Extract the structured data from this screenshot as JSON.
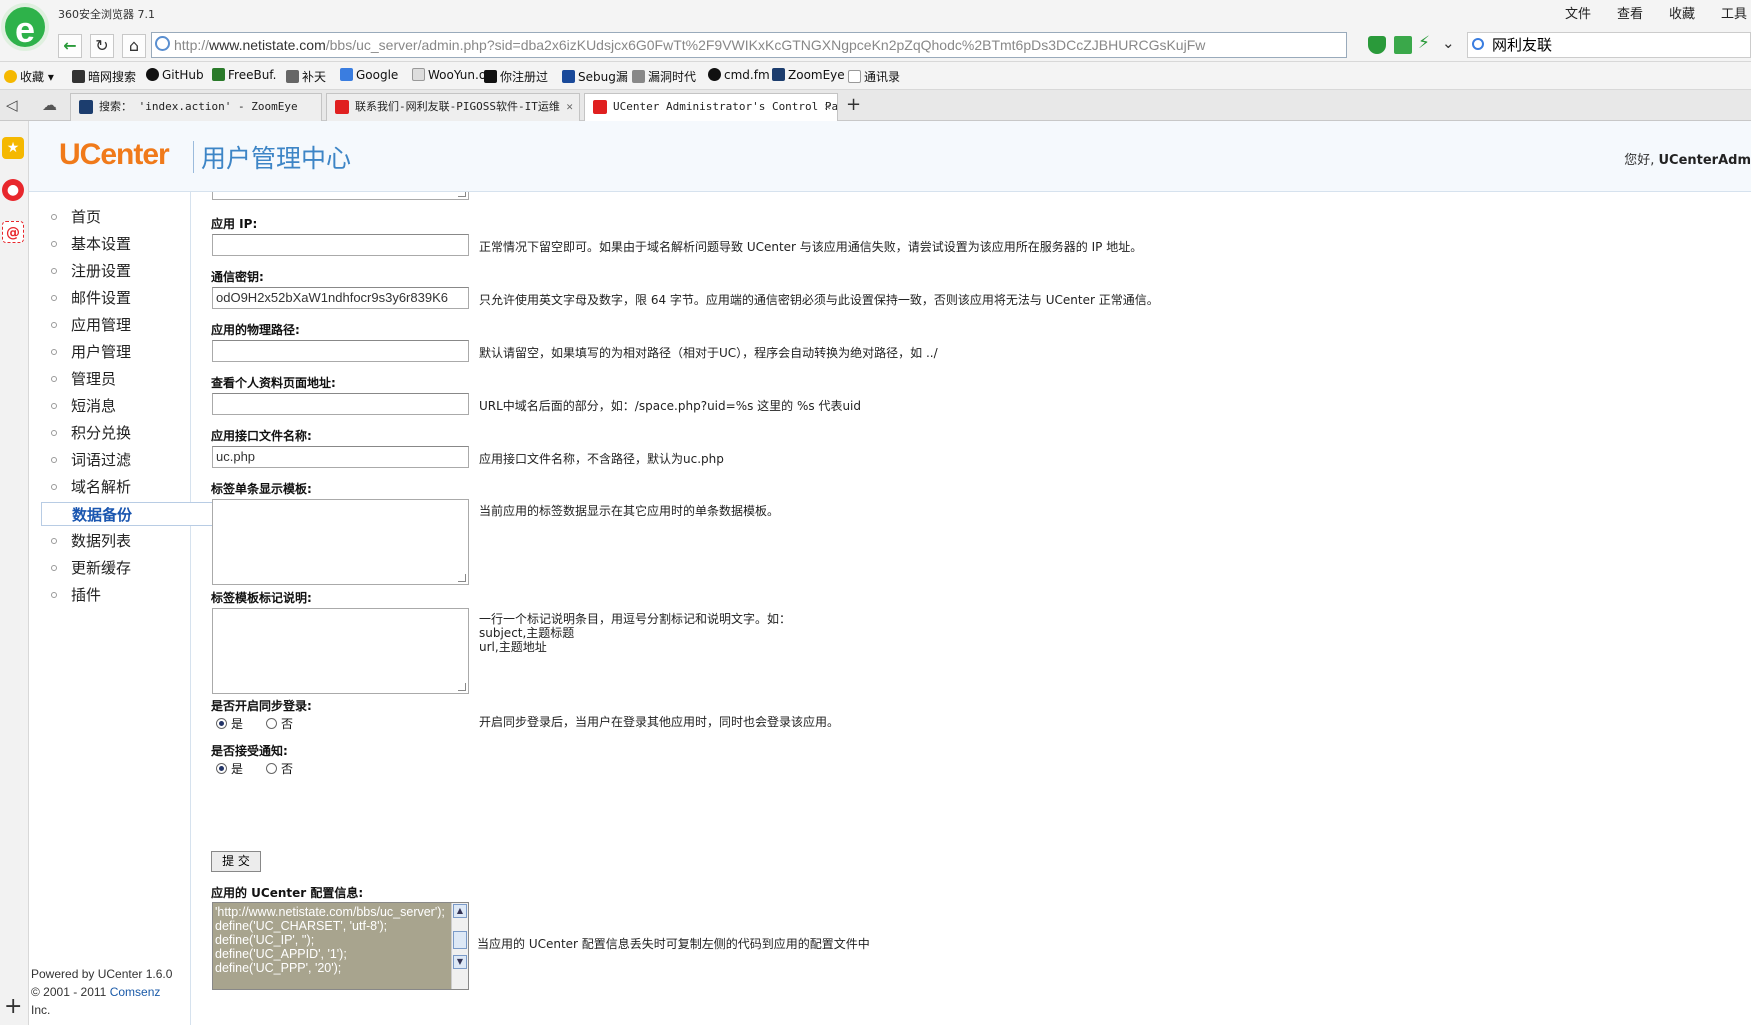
{
  "browser": {
    "app_name": "360安全浏览器 7.1",
    "menu": [
      "文件",
      "查看",
      "收藏",
      "工具"
    ],
    "address": {
      "protocol": "http://",
      "domain": "www.netistate.com",
      "path": "/bbs/uc_server/admin.php?sid=dba2x6izKUdsjcx6G0FwTt%2F9VWIKxKcGTNGXNgpceKn2pZqQhodc%2BTmt6pDs3DCcZJBHURCGsKujFw"
    },
    "search_value": "网利友联",
    "bookmarks": [
      "收藏",
      "暗网搜索",
      "GitHub",
      "FreeBuf.",
      "补天",
      "Google",
      "WooYun.o",
      "你注册过",
      "Sebug漏",
      "漏洞时代",
      "cmd.fm",
      "ZoomEye",
      "通讯录"
    ],
    "tabs": [
      {
        "label": "搜索： 'index.action' - ZoomEye",
        "icon_color": "#1c3d6e"
      },
      {
        "label": "联系我们-网利友联-PIGOSS软件-IT运维",
        "icon_color": "#e02020"
      },
      {
        "label": "UCenter Administrator's Control Pa",
        "icon_color": "#e02020"
      }
    ]
  },
  "header": {
    "brand": "UCenter",
    "title": "用户管理中心",
    "greeting": "您好,",
    "user": "UCenterAdm"
  },
  "sidebar": {
    "items": [
      {
        "label": "首页"
      },
      {
        "label": "基本设置"
      },
      {
        "label": "注册设置"
      },
      {
        "label": "邮件设置"
      },
      {
        "label": "应用管理"
      },
      {
        "label": "用户管理"
      },
      {
        "label": "管理员"
      },
      {
        "label": "短消息"
      },
      {
        "label": "积分兑换"
      },
      {
        "label": "词语过滤"
      },
      {
        "label": "域名解析"
      },
      {
        "label": "数据备份"
      },
      {
        "label": "数据列表"
      },
      {
        "label": "更新缓存"
      },
      {
        "label": "插件"
      }
    ],
    "active": "数据备份",
    "powered_line1": "Powered by UCenter 1.6.0",
    "powered_line2a": "© 2001 - 2011 ",
    "powered_link": "Comsenz",
    "powered_line3": "Inc."
  },
  "form": {
    "app_ip": {
      "label": "应用 IP:",
      "value": "",
      "hint": "正常情况下留空即可。如果由于域名解析问题导致 UCenter 与该应用通信失败，请尝试设置为该应用所在服务器的 IP 地址。"
    },
    "comm_key": {
      "label": "通信密钥:",
      "value": "odO9H2x52bXaW1ndhfocr9s3y6r839K6",
      "hint": "只允许使用英文字母及数字，限 64 字节。应用端的通信密钥必须与此设置保持一致，否则该应用将无法与 UCenter 正常通信。"
    },
    "physical_path": {
      "label": "应用的物理路径:",
      "value": "",
      "hint": "默认请留空，如果填写的为相对路径（相对于UC），程序会自动转换为绝对路径，如 ../"
    },
    "profile_url": {
      "label": "查看个人资料页面地址:",
      "value": "",
      "hint": "URL中域名后面的部分，如：/space.php?uid=%s 这里的 %s 代表uid"
    },
    "api_file": {
      "label": "应用接口文件名称:",
      "value": "uc.php",
      "hint": "应用接口文件名称，不含路径，默认为uc.php"
    },
    "tag_template": {
      "label": "标签单条显示模板:",
      "hint": "当前应用的标签数据显示在其它应用时的单条数据模板。"
    },
    "tag_desc": {
      "label": "标签模板标记说明:",
      "hint_lines": [
        "一行一个标记说明条目，用逗号分割标记和说明文字。如：",
        "subject,主题标题",
        "url,主题地址"
      ]
    },
    "sync_login": {
      "label": "是否开启同步登录:",
      "yes": "是",
      "no": "否",
      "selected": "是",
      "hint": "开启同步登录后，当用户在登录其他应用时，同时也会登录该应用。"
    },
    "receive_notify": {
      "label": "是否接受通知:",
      "yes": "是",
      "no": "否",
      "selected": "是"
    },
    "submit": "提 交",
    "config": {
      "label": "应用的 UCenter 配置信息:",
      "text": "'http://www.netistate.com/bbs/uc_server');\ndefine('UC_CHARSET', 'utf-8');\ndefine('UC_IP', '');\ndefine('UC_APPID', '1');\ndefine('UC_PPP', '20');",
      "hint": "当应用的 UCenter 配置信息丢失时可复制左侧的代码到应用的配置文件中"
    }
  }
}
